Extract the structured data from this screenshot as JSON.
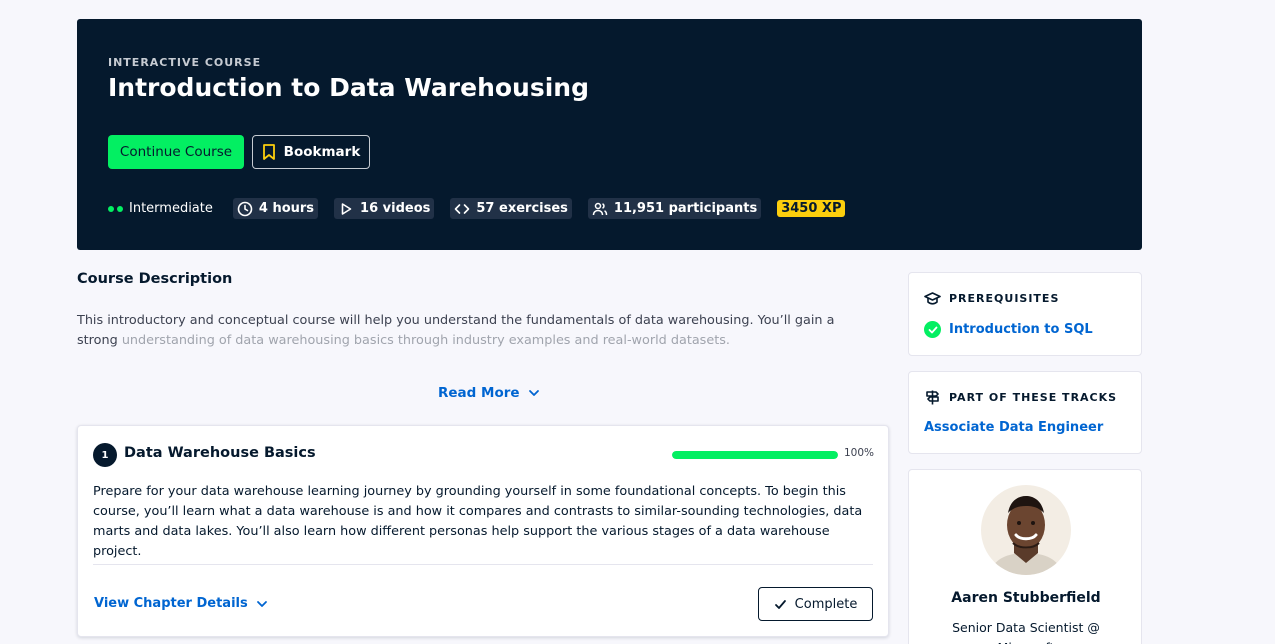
{
  "hero": {
    "eyebrow": "INTERACTIVE COURSE",
    "title": "Introduction to Data Warehousing",
    "continue_label": "Continue Course",
    "bookmark_label": "Bookmark",
    "meta": {
      "level": "Intermediate",
      "duration": "4 hours",
      "videos": "16 videos",
      "exercises": "57 exercises",
      "participants": "11,951 participants",
      "xp": "3450 XP"
    }
  },
  "description": {
    "heading": "Course Description",
    "text_visible": "This introductory and conceptual course will help you understand the fundamentals of data warehousing. You’ll gain a strong",
    "text_faded": "understanding of data warehousing basics through industry examples and real-world datasets.",
    "read_more": "Read More"
  },
  "chapter": {
    "number": "1",
    "title": "Data Warehouse Basics",
    "progress": 100,
    "progress_label": "100%",
    "description": "Prepare for your data warehouse learning journey by grounding yourself in some foundational concepts. To begin this course, you’ll learn what a data warehouse is and how it compares and contrasts to similar-sounding technologies, data marts and data lakes. You’ll also learn how different personas help support the various stages of a data warehouse project.",
    "view_details": "View Chapter Details",
    "complete_label": "Complete"
  },
  "sidebar": {
    "prereq_heading": "PREREQUISITES",
    "prereq_item": "Introduction to SQL",
    "tracks_heading": "PART OF THESE TRACKS",
    "track_item": "Associate Data Engineer",
    "instructor_name": "Aaren Stubberfield",
    "instructor_role": "Senior Data Scientist @ Microsoft"
  },
  "colors": {
    "navy": "#05192d",
    "green": "#03ef62",
    "blue_link": "#0065d1",
    "xp_yellow": "#fcce0d"
  },
  "icons": [
    "bookmark-icon",
    "clock-icon",
    "play-icon",
    "code-icon",
    "users-icon",
    "chevron-down-icon",
    "check-icon",
    "graduation-cap-icon",
    "signpost-icon"
  ]
}
